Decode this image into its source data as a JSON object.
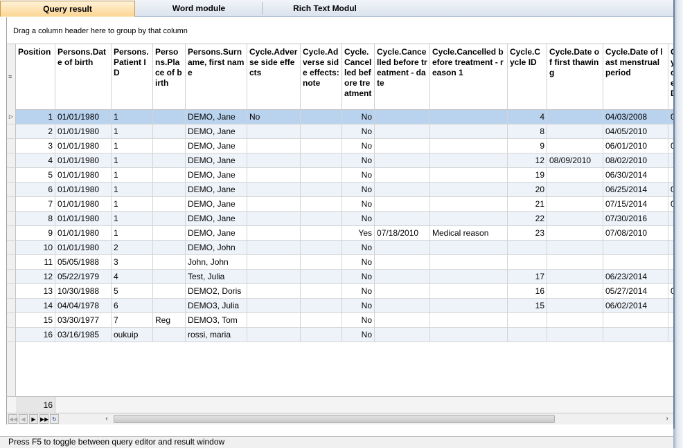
{
  "tabs": [
    {
      "label": "Query result",
      "active": true
    },
    {
      "label": "Word module",
      "active": false
    },
    {
      "label": "Rich Text Modul",
      "active": false
    }
  ],
  "group_panel": {
    "text": "Drag a column header here to group by that column"
  },
  "columns": [
    {
      "key": "pos",
      "label": "Position"
    },
    {
      "key": "dob",
      "label": "Persons.Date of birth"
    },
    {
      "key": "pid",
      "label": "Persons.Patient ID"
    },
    {
      "key": "pob",
      "label": "Persons.Place of birth"
    },
    {
      "key": "name",
      "label": "Persons.Surname, first name"
    },
    {
      "key": "adv",
      "label": "Cycle.Adverse side effects"
    },
    {
      "key": "advnote",
      "label": "Cycle.Adverse side effects: note"
    },
    {
      "key": "canc",
      "label": "Cycle.Cancelled before treatment"
    },
    {
      "key": "cdate",
      "label": "Cycle.Cancelled before treatment - date"
    },
    {
      "key": "creason",
      "label": "Cycle.Cancelled before treatment - reason 1"
    },
    {
      "key": "cid",
      "label": "Cycle.Cycle ID"
    },
    {
      "key": "thaw",
      "label": "Cycle.Date of first thawing"
    },
    {
      "key": "lmp",
      "label": "Cycle.Date of last menstrual period"
    },
    {
      "key": "extra",
      "label": "Cycle.D..."
    }
  ],
  "rows": [
    {
      "pos": "1",
      "dob": "01/01/1980",
      "pid": "1",
      "pob": "",
      "name": "DEMO, Jane",
      "adv": "No",
      "advnote": "",
      "canc": "No",
      "cdate": "",
      "creason": "",
      "cid": "4",
      "thaw": "",
      "lmp": "04/03/2008",
      "extra": "0"
    },
    {
      "pos": "2",
      "dob": "01/01/1980",
      "pid": "1",
      "pob": "",
      "name": "DEMO, Jane",
      "adv": "",
      "advnote": "",
      "canc": "No",
      "cdate": "",
      "creason": "",
      "cid": "8",
      "thaw": "",
      "lmp": "04/05/2010",
      "extra": ""
    },
    {
      "pos": "3",
      "dob": "01/01/1980",
      "pid": "1",
      "pob": "",
      "name": "DEMO, Jane",
      "adv": "",
      "advnote": "",
      "canc": "No",
      "cdate": "",
      "creason": "",
      "cid": "9",
      "thaw": "",
      "lmp": "06/01/2010",
      "extra": "0"
    },
    {
      "pos": "4",
      "dob": "01/01/1980",
      "pid": "1",
      "pob": "",
      "name": "DEMO, Jane",
      "adv": "",
      "advnote": "",
      "canc": "No",
      "cdate": "",
      "creason": "",
      "cid": "12",
      "thaw": "08/09/2010",
      "lmp": "08/02/2010",
      "extra": ""
    },
    {
      "pos": "5",
      "dob": "01/01/1980",
      "pid": "1",
      "pob": "",
      "name": "DEMO, Jane",
      "adv": "",
      "advnote": "",
      "canc": "No",
      "cdate": "",
      "creason": "",
      "cid": "19",
      "thaw": "",
      "lmp": "06/30/2014",
      "extra": ""
    },
    {
      "pos": "6",
      "dob": "01/01/1980",
      "pid": "1",
      "pob": "",
      "name": "DEMO, Jane",
      "adv": "",
      "advnote": "",
      "canc": "No",
      "cdate": "",
      "creason": "",
      "cid": "20",
      "thaw": "",
      "lmp": "06/25/2014",
      "extra": "0"
    },
    {
      "pos": "7",
      "dob": "01/01/1980",
      "pid": "1",
      "pob": "",
      "name": "DEMO, Jane",
      "adv": "",
      "advnote": "",
      "canc": "No",
      "cdate": "",
      "creason": "",
      "cid": "21",
      "thaw": "",
      "lmp": "07/15/2014",
      "extra": "0"
    },
    {
      "pos": "8",
      "dob": "01/01/1980",
      "pid": "1",
      "pob": "",
      "name": "DEMO, Jane",
      "adv": "",
      "advnote": "",
      "canc": "No",
      "cdate": "",
      "creason": "",
      "cid": "22",
      "thaw": "",
      "lmp": "07/30/2016",
      "extra": ""
    },
    {
      "pos": "9",
      "dob": "01/01/1980",
      "pid": "1",
      "pob": "",
      "name": "DEMO, Jane",
      "adv": "",
      "advnote": "",
      "canc": "Yes",
      "cdate": "07/18/2010",
      "creason": "Medical reason",
      "cid": "23",
      "thaw": "",
      "lmp": "07/08/2010",
      "extra": ""
    },
    {
      "pos": "10",
      "dob": "01/01/1980",
      "pid": "2",
      "pob": "",
      "name": "DEMO, John",
      "adv": "",
      "advnote": "",
      "canc": "No",
      "cdate": "",
      "creason": "",
      "cid": "",
      "thaw": "",
      "lmp": "",
      "extra": ""
    },
    {
      "pos": "11",
      "dob": "05/05/1988",
      "pid": "3",
      "pob": "",
      "name": "John, John",
      "adv": "",
      "advnote": "",
      "canc": "No",
      "cdate": "",
      "creason": "",
      "cid": "",
      "thaw": "",
      "lmp": "",
      "extra": ""
    },
    {
      "pos": "12",
      "dob": "05/22/1979",
      "pid": "4",
      "pob": "",
      "name": "Test, Julia",
      "adv": "",
      "advnote": "",
      "canc": "No",
      "cdate": "",
      "creason": "",
      "cid": "17",
      "thaw": "",
      "lmp": "06/23/2014",
      "extra": ""
    },
    {
      "pos": "13",
      "dob": "10/30/1988",
      "pid": "5",
      "pob": "",
      "name": "DEMO2, Doris",
      "adv": "",
      "advnote": "",
      "canc": "No",
      "cdate": "",
      "creason": "",
      "cid": "16",
      "thaw": "",
      "lmp": "05/27/2014",
      "extra": "0"
    },
    {
      "pos": "14",
      "dob": "04/04/1978",
      "pid": "6",
      "pob": "",
      "name": "DEMO3, Julia",
      "adv": "",
      "advnote": "",
      "canc": "No",
      "cdate": "",
      "creason": "",
      "cid": "15",
      "thaw": "",
      "lmp": "06/02/2014",
      "extra": ""
    },
    {
      "pos": "15",
      "dob": "03/30/1977",
      "pid": "7",
      "pob": "Reg",
      "name": "DEMO3, Tom",
      "adv": "",
      "advnote": "",
      "canc": "No",
      "cdate": "",
      "creason": "",
      "cid": "",
      "thaw": "",
      "lmp": "",
      "extra": ""
    },
    {
      "pos": "16",
      "dob": "03/16/1985",
      "pid": "oukuip",
      "pob": "",
      "name": "rossi, maria",
      "adv": "",
      "advnote": "",
      "canc": "No",
      "cdate": "",
      "creason": "",
      "cid": "",
      "thaw": "",
      "lmp": "",
      "extra": ""
    }
  ],
  "footer": {
    "count": "16"
  },
  "status_bar": {
    "text": "Press F5 to toggle between query editor and result window"
  }
}
